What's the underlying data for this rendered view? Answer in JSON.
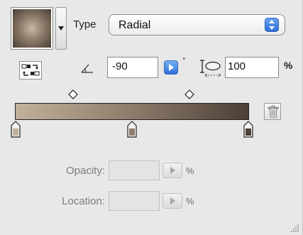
{
  "gradient": {
    "type_label": "Type",
    "type_value": "Radial",
    "angle_value": "-90",
    "degree_symbol": "°",
    "aspect_value": "100",
    "aspect_unit": "%",
    "ramp_colors": [
      "#c1b19a",
      "#8d7c6b",
      "#4d3f36"
    ],
    "stops": [
      {
        "name": "gradient-stop-left",
        "color": "#c1b19a",
        "position_percent": 0
      },
      {
        "name": "gradient-stop-middle",
        "color": "#8d7c6b",
        "position_percent": 50
      },
      {
        "name": "gradient-stop-right",
        "color": "#4d3f36",
        "position_percent": 100
      }
    ],
    "midpoints_percent": [
      25,
      75
    ]
  },
  "stop_props": {
    "opacity_label": "Opacity:",
    "opacity_value": "",
    "opacity_unit": "%",
    "location_label": "Location:",
    "location_value": "",
    "location_unit": "%"
  },
  "icons": {
    "swatch_menu": "triangle-down-icon",
    "type_select": "up-down-arrows-icon",
    "reverse": "reverse-gradient-icon",
    "angle": "angle-icon",
    "aspect": "aspect-ratio-icon",
    "delete_stop": "trash-icon"
  }
}
